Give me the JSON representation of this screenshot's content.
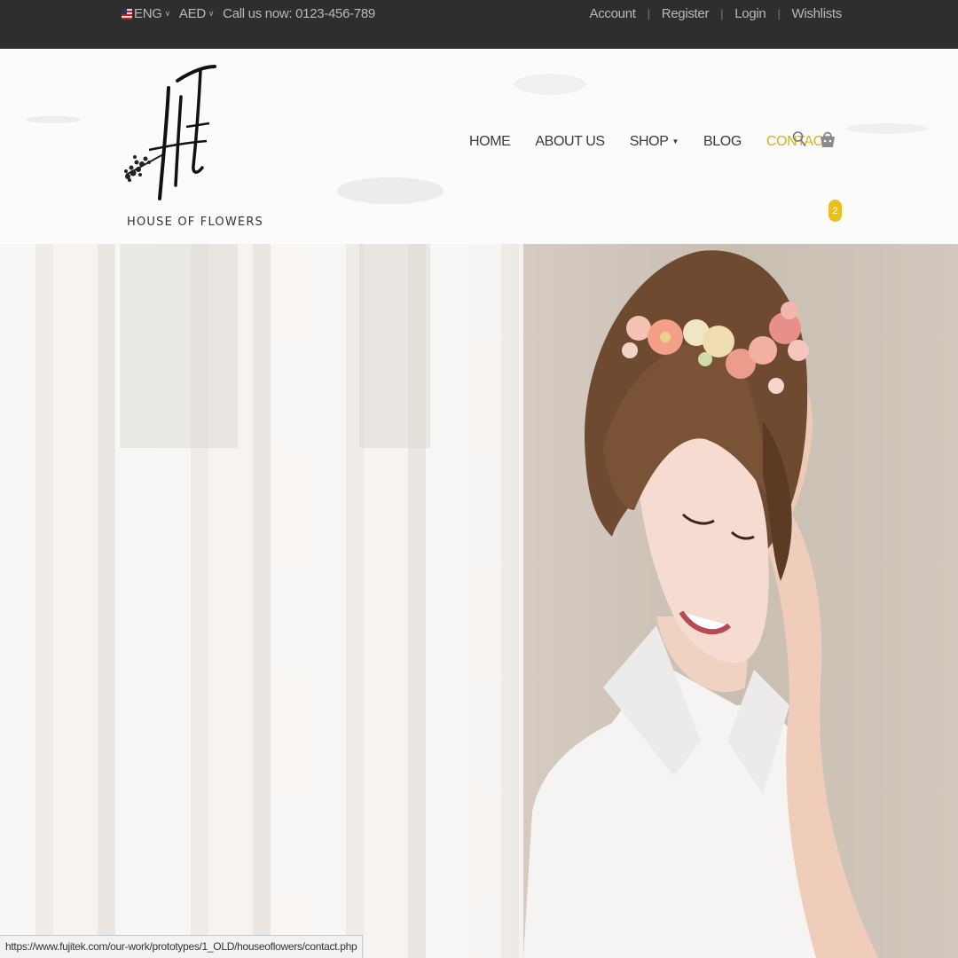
{
  "topbar": {
    "language": "ENG",
    "currency": "AED",
    "phone": "Call us now: 0123-456-789",
    "links": [
      "Account",
      "Register",
      "Login",
      "Wishlists"
    ]
  },
  "header": {
    "logo_text": "HOUSE OF FLOWERS",
    "nav": [
      "HOME",
      "ABOUT US",
      "SHOP",
      "BLOG",
      "CONTACT"
    ],
    "active_nav": "CONTACT",
    "cart_count": "2",
    "accent_color": "#d4b21c"
  },
  "status_bar": {
    "url": "https://www.fujitek.com/our-work/prototypes/1_OLD/houseoflowers/contact.php"
  },
  "icons": [
    "us-flag-icon",
    "chevron-down-icon",
    "search-icon",
    "cart-icon"
  ]
}
